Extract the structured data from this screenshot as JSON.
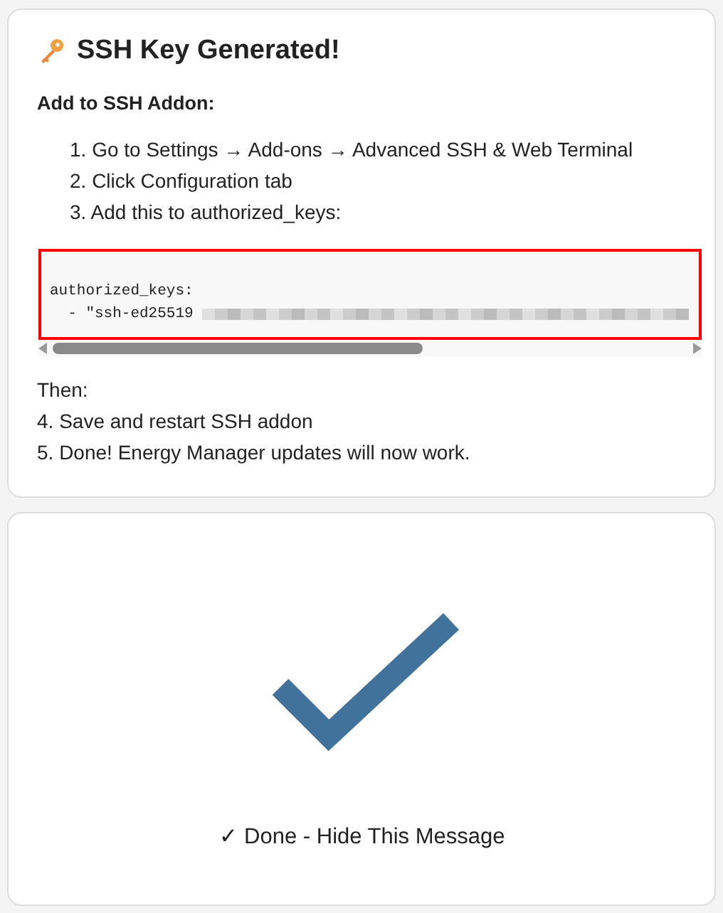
{
  "setup_card": {
    "title": "SSH Key Generated!",
    "subtitle": "Add to SSH Addon:",
    "steps": [
      "1. Go to Settings → Add-ons → Advanced SSH & Web Terminal",
      "2. Click Configuration tab",
      "3. Add this to authorized_keys:"
    ],
    "code": {
      "line_1": "authorized_keys:",
      "line_2": "  - \"ssh-ed25519",
      "redacted": true
    },
    "after_label": "Then:",
    "after_steps": [
      "4. Save and restart SSH addon",
      "5. Done! Energy Manager updates will now work."
    ]
  },
  "done_card": {
    "button": "✓ Done - Hide This Message"
  }
}
